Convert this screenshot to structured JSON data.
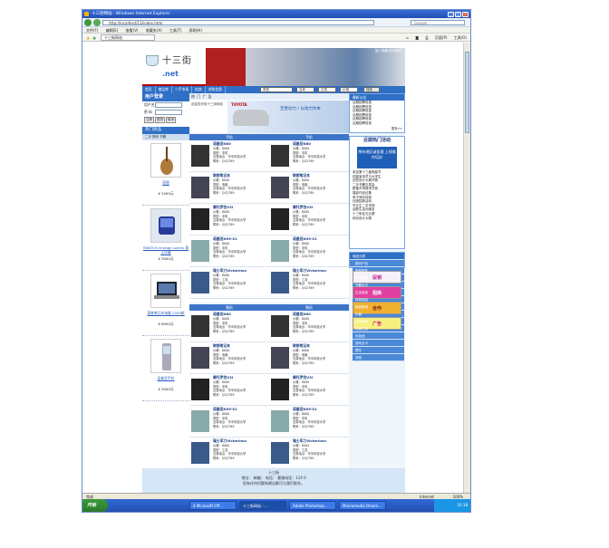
{
  "window": {
    "title": "十三街网站 - Windows Internet Explorer",
    "url": "http://localhost/13/index.html",
    "search_placeholder": "Google"
  },
  "menu": [
    "文件(F)",
    "编辑(E)",
    "查看(V)",
    "收藏夹(A)",
    "工具(T)",
    "帮助(H)"
  ],
  "fav": {
    "tab": "十三街网站",
    "tools": [
      "页面(P)",
      "工具(O)"
    ]
  },
  "site": {
    "logo_name": "十三街",
    "logo_net": ".net",
    "banner_links": "加入收藏 设为首页",
    "nav": [
      "首页",
      "商品库",
      "二手市场",
      "拍卖",
      "求购信息"
    ],
    "nav_selects": [
      "类型",
      "名称",
      "交易",
      "价格"
    ],
    "nav_button": "搜索",
    "login": {
      "title": "用户登录",
      "user_label": "用户名",
      "pass_label": "密 码",
      "buttons": [
        "注册",
        "登录",
        "取消"
      ]
    },
    "ad_header": [
      "热",
      "门",
      "广",
      "告"
    ],
    "ad_note": "欢迎您光临十三街网站",
    "ad_brand": "TOYOTA",
    "ad_slogan": "至善动力 / 以动力为本",
    "left_sec": "热门商品",
    "left_sub": "二手 数码 书籍",
    "goods": [
      {
        "name": "琵琶",
        "price": "¥ 1000元"
      },
      {
        "name": "SWATCH Vintage Lovers 真正珍藏",
        "price": "¥ 3000元"
      },
      {
        "name": "惠普笔记本电脑 2009款",
        "price": "¥ 6000元"
      },
      {
        "name": "诺基亚手机",
        "price": "¥ 3000元"
      }
    ],
    "cat_headers_a": [
      "手机",
      "手机"
    ],
    "cat_headers_b": [
      "数码",
      "数码"
    ],
    "products": [
      {
        "title": "诺基亚N80",
        "lines": [
          "价格：8000",
          "类型：手机",
          "交易地点：华中科技大学",
          "联系：QQ2789"
        ]
      },
      {
        "title": "诺基亚N80",
        "lines": [
          "价格：8000",
          "类型：手机",
          "交易地点：华中科技大学",
          "联系：QQ2789"
        ]
      },
      {
        "title": "联想笔记本",
        "lines": [
          "价格：8000",
          "类型：电脑",
          "交易地点：华中科技大学",
          "联系：QQ2789"
        ]
      },
      {
        "title": "联想笔记本",
        "lines": [
          "价格：8000",
          "类型：电脑",
          "交易地点：华中科技大学",
          "联系：QQ2789"
        ]
      },
      {
        "title": "摩托罗拉V3i",
        "lines": [
          "价格：8000",
          "类型：手机",
          "交易地点：华中科技大学",
          "联系：QQ2789"
        ]
      },
      {
        "title": "摩托罗拉V3i",
        "lines": [
          "价格：8000",
          "类型：手机",
          "交易地点：华中科技大学",
          "联系：QQ2789"
        ]
      },
      {
        "title": "诺基亚N95-S1",
        "lines": [
          "价格：8000",
          "类型：手机",
          "交易地点：华中科技大学",
          "联系：QQ2789"
        ]
      },
      {
        "title": "诺基亚N95-S1",
        "lines": [
          "价格：8000",
          "类型：手机",
          "交易地点：华中科技大学",
          "联系：QQ2789"
        ]
      },
      {
        "title": "瑞士军刀Victorinox",
        "lines": [
          "价格：8000",
          "类型：工具",
          "交易地点：华中科技大学",
          "联系：QQ2789"
        ]
      },
      {
        "title": "瑞士军刀Victorinox",
        "lines": [
          "价格：8000",
          "类型：工具",
          "交易地点：华中科技大学",
          "联系：QQ2789"
        ]
      }
    ],
    "right_news_h": "最新公告",
    "right_news": [
      "近期招聘信息",
      "近期招聘信息",
      "近期招聘信息",
      "近期招聘信息",
      "近期招聘信息",
      "近期招聘信息"
    ],
    "right_news_more": "更多>>",
    "right_act_h": "近期热门活动",
    "right_promo": "荆州地区诚信通 上线操作培训",
    "right_acts": [
      "参加第十三届电脑节",
      "招募宣传员与大学生",
      "创意设计大赛开赛",
      "二手书籍交易会",
      "跳蚤市场周末开放",
      "摄影作品征集",
      "电子商务讲座",
      "社团招新活动",
      "毕业生二手市场",
      "迎新生活动报名",
      "十三街征文比赛",
      "网页设计大赛"
    ],
    "links_h": "商品分类",
    "links": [
      "数码产品",
      "电脑配件",
      "手机通讯",
      "书籍杂志",
      "生活用品",
      "体育用品",
      "服装鞋帽",
      "乐器",
      "家用电器",
      "交通工具",
      "化妆品",
      "游戏点卡",
      "票务",
      "其他"
    ],
    "adv": [
      "促销",
      "招商",
      "合作",
      "广告"
    ],
    "footer": [
      "十三街",
      "地址：   邮编：   电话：   客服电话：114 0",
      "您有任何问题和建议都可与我们联系。"
    ]
  },
  "status": {
    "text": "完成",
    "zone": "Internet",
    "zoom": "100%"
  },
  "taskbar": {
    "start": "开始",
    "tasks": [
      "4 Microsoft Off...",
      "十三街网站 - ...",
      "Adobe Photoshop...",
      "Macromedia Dream..."
    ],
    "clock": "10:18"
  },
  "colors": {
    "site_blue": "#2f6fc5",
    "title_blue": "#1f4fb3"
  }
}
